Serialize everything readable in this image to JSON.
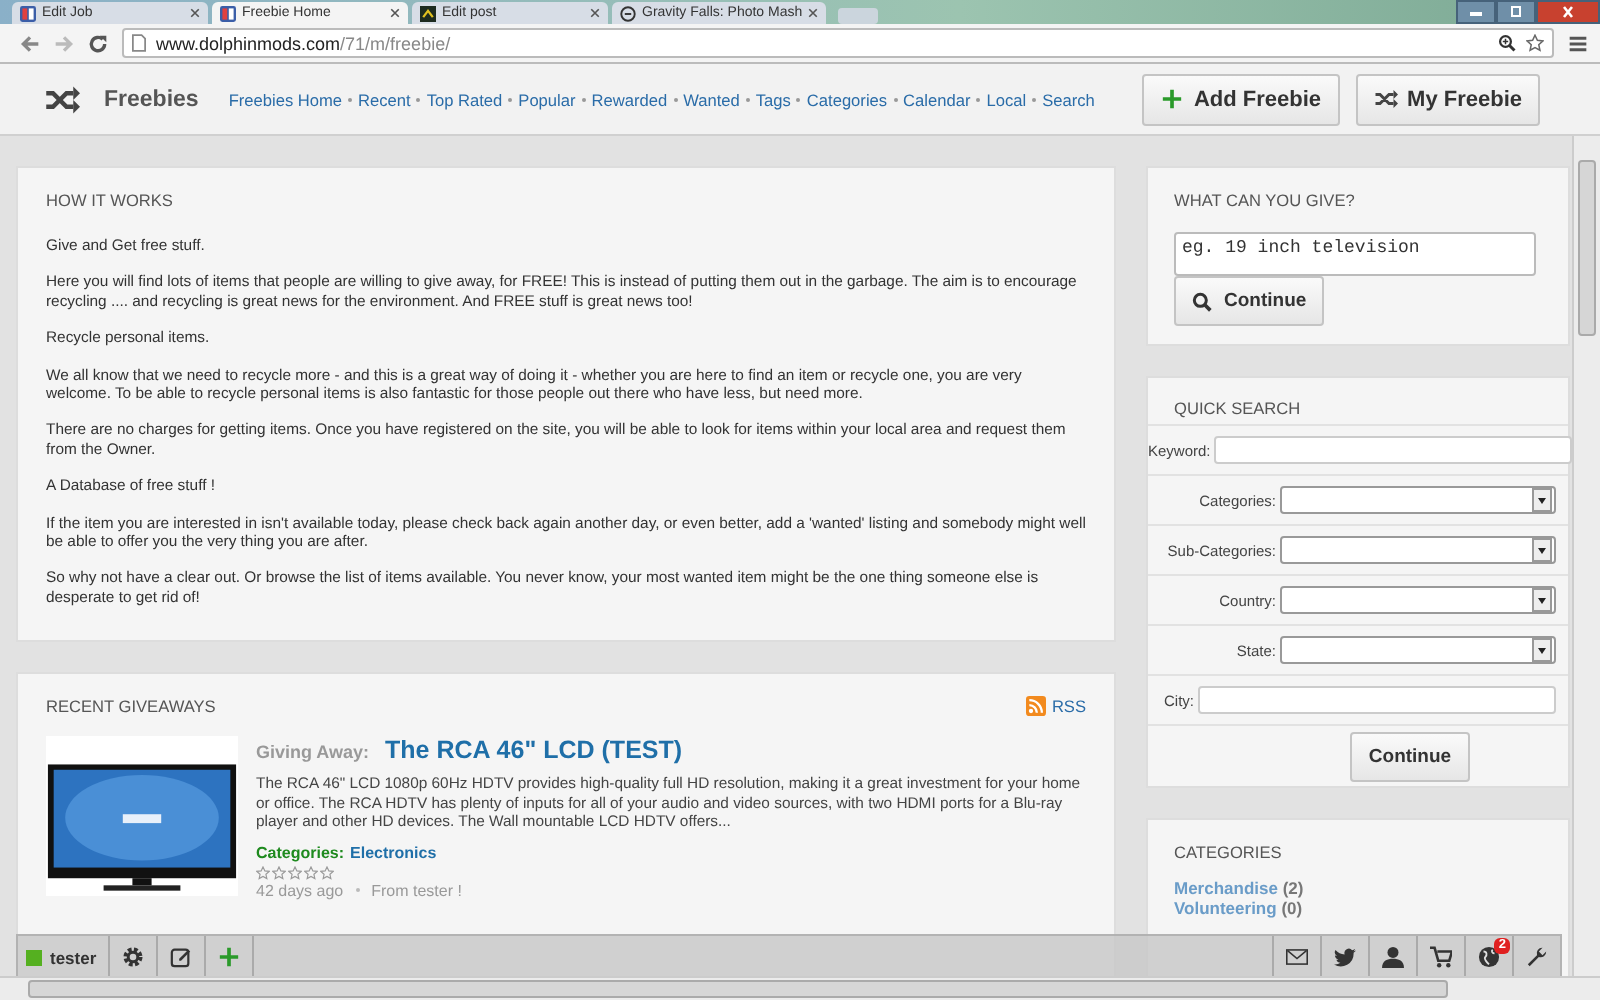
{
  "browser": {
    "tabs": [
      {
        "title": "Edit Job",
        "selected": false
      },
      {
        "title": "Freebie Home",
        "selected": true
      },
      {
        "title": "Edit post",
        "selected": false
      },
      {
        "title": "Gravity Falls: Photo Mash",
        "selected": false
      }
    ],
    "url": {
      "host": "www.dolphinmods.com",
      "path": "/71/m/freebie/"
    }
  },
  "header": {
    "logo": "Freebies",
    "nav": [
      "Freebies Home",
      "Recent",
      "Top Rated",
      "Popular",
      "Rewarded",
      "Wanted",
      "Tags",
      "Categories",
      "Calendar",
      "Local",
      "Search"
    ],
    "buttons": [
      "Add Freebie",
      "My Freebie"
    ]
  },
  "how_it_works": {
    "heading": "HOW IT WORKS",
    "paragraphs": [
      "Give and Get free stuff.",
      "Here you will find lots of items that people are willing to give away, for FREE! This is instead of putting them out in the garbage. The aim is to encourage recycling .... and recycling is great news for the environment. And FREE stuff is great news too!",
      "Recycle personal items.",
      "We all know that we need to recycle more - and this is a great way of doing it - whether you are here to find an item or recycle one, you are very welcome. To be able to recycle personal items is also fantastic for those people out there who have less, but need more.",
      "There are no charges for getting items. Once you have registered on the site, you will be able to look for items within your local area and request them from the Owner.",
      "A Database of free stuff !",
      "If the item you are interested in isn't available today, please check back again another day, or even better, add a 'wanted' listing and somebody might well be able to offer you the very thing you are after.",
      "So why not have a clear out. Or browse the list of items available. You never know, your most wanted item might be the one thing someone else is desperate to get rid of!"
    ]
  },
  "recent": {
    "heading": "RECENT GIVEAWAYS",
    "rss": "RSS",
    "items": [
      {
        "prefix": "Giving Away:",
        "title": "The RCA 46\" LCD (TEST)",
        "description": "The RCA 46\" LCD 1080p 60Hz HDTV provides high-quality full HD resolution, making it a great investment for your home or office. The RCA HDTV has plenty of inputs for all of your audio and video sources, with two HDMI ports for a Blu-ray player and other HD devices. The Wall mountable LCD HDTV offers...",
        "categories_label": "Categories:",
        "category": "Electronics",
        "stars": 0,
        "age": "42 days ago",
        "from": "From tester !"
      }
    ]
  },
  "give": {
    "heading": "WHAT CAN YOU GIVE?",
    "placeholder": "eg. 19 inch television",
    "button": "Continue"
  },
  "quick_search": {
    "heading": "QUICK SEARCH",
    "fields": [
      {
        "label": "Keyword:",
        "kind": "text"
      },
      {
        "label": "Categories:",
        "kind": "select"
      },
      {
        "label": "Sub-Categories:",
        "kind": "select"
      },
      {
        "label": "Country:",
        "kind": "select"
      },
      {
        "label": "State:",
        "kind": "select"
      },
      {
        "label": "City:",
        "kind": "text"
      }
    ],
    "button": "Continue"
  },
  "categories": {
    "heading": "CATEGORIES",
    "items": [
      {
        "name": "Merchandise",
        "count": "(2)"
      },
      {
        "name": "Volunteering",
        "count": "(0)"
      }
    ]
  },
  "toolbar": {
    "user": "tester",
    "notification_badge": "2"
  }
}
